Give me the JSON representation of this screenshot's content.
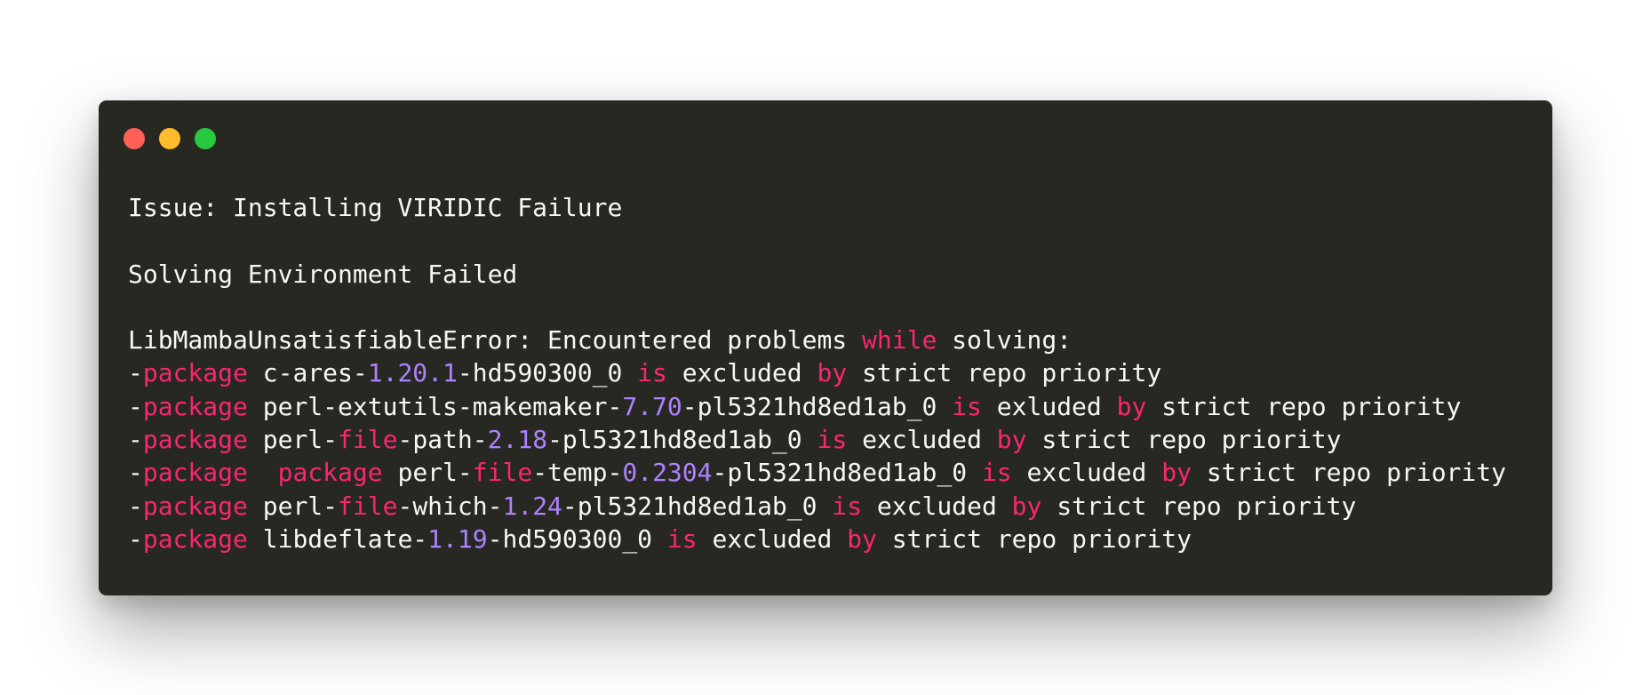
{
  "colors": {
    "background": "#ffffff",
    "window_bg": "#272822",
    "text": "#f8f8f2",
    "keyword": "#f92672",
    "number": "#ae81ff",
    "close": "#ff5f56",
    "minimize": "#ffbd2e",
    "zoom": "#27c93f"
  },
  "window_controls": [
    {
      "name": "close-button",
      "icon": "red-circle-icon",
      "color": "#ff5f56"
    },
    {
      "name": "minimize-button",
      "icon": "yellow-circle-icon",
      "color": "#ffbd2e"
    },
    {
      "name": "zoom-button",
      "icon": "green-circle-icon",
      "color": "#27c93f"
    }
  ],
  "code_lines": [
    [
      {
        "t": "Issue: Installing VIRIDIC Failure",
        "k": "plain"
      }
    ],
    [],
    [
      {
        "t": "Solving Environment Failed",
        "k": "plain"
      }
    ],
    [],
    [
      {
        "t": "LibMambaUnsatisfiableError: Encountered problems ",
        "k": "plain"
      },
      {
        "t": "while",
        "k": "kw"
      },
      {
        "t": " solving:",
        "k": "plain"
      }
    ],
    [
      {
        "t": "-",
        "k": "plain"
      },
      {
        "t": "package",
        "k": "kw"
      },
      {
        "t": " c-ares-",
        "k": "plain"
      },
      {
        "t": "1.20.1",
        "k": "num"
      },
      {
        "t": "-hd590300_0 ",
        "k": "plain"
      },
      {
        "t": "is",
        "k": "kw"
      },
      {
        "t": " excluded ",
        "k": "plain"
      },
      {
        "t": "by",
        "k": "kw"
      },
      {
        "t": " strict repo priority",
        "k": "plain"
      }
    ],
    [
      {
        "t": "-",
        "k": "plain"
      },
      {
        "t": "package",
        "k": "kw"
      },
      {
        "t": " perl-extutils-makemaker-",
        "k": "plain"
      },
      {
        "t": "7.70",
        "k": "num"
      },
      {
        "t": "-pl5321hd8ed1ab_0 ",
        "k": "plain"
      },
      {
        "t": "is",
        "k": "kw"
      },
      {
        "t": " exluded ",
        "k": "plain"
      },
      {
        "t": "by",
        "k": "kw"
      },
      {
        "t": " strict repo priority",
        "k": "plain"
      }
    ],
    [
      {
        "t": "-",
        "k": "plain"
      },
      {
        "t": "package",
        "k": "kw"
      },
      {
        "t": " perl-",
        "k": "plain"
      },
      {
        "t": "file",
        "k": "kw"
      },
      {
        "t": "-path-",
        "k": "plain"
      },
      {
        "t": "2.18",
        "k": "num"
      },
      {
        "t": "-pl5321hd8ed1ab_0 ",
        "k": "plain"
      },
      {
        "t": "is",
        "k": "kw"
      },
      {
        "t": " excluded ",
        "k": "plain"
      },
      {
        "t": "by",
        "k": "kw"
      },
      {
        "t": " strict repo priority",
        "k": "plain"
      }
    ],
    [
      {
        "t": "-",
        "k": "plain"
      },
      {
        "t": "package",
        "k": "kw"
      },
      {
        "t": "  ",
        "k": "plain"
      },
      {
        "t": "package",
        "k": "kw"
      },
      {
        "t": " perl-",
        "k": "plain"
      },
      {
        "t": "file",
        "k": "kw"
      },
      {
        "t": "-temp-",
        "k": "plain"
      },
      {
        "t": "0.2304",
        "k": "num"
      },
      {
        "t": "-pl5321hd8ed1ab_0 ",
        "k": "plain"
      },
      {
        "t": "is",
        "k": "kw"
      },
      {
        "t": " excluded ",
        "k": "plain"
      },
      {
        "t": "by",
        "k": "kw"
      },
      {
        "t": " strict repo priority",
        "k": "plain"
      }
    ],
    [
      {
        "t": "-",
        "k": "plain"
      },
      {
        "t": "package",
        "k": "kw"
      },
      {
        "t": " perl-",
        "k": "plain"
      },
      {
        "t": "file",
        "k": "kw"
      },
      {
        "t": "-which-",
        "k": "plain"
      },
      {
        "t": "1.24",
        "k": "num"
      },
      {
        "t": "-pl5321hd8ed1ab_0 ",
        "k": "plain"
      },
      {
        "t": "is",
        "k": "kw"
      },
      {
        "t": " excluded ",
        "k": "plain"
      },
      {
        "t": "by",
        "k": "kw"
      },
      {
        "t": " strict repo priority",
        "k": "plain"
      }
    ],
    [
      {
        "t": "-",
        "k": "plain"
      },
      {
        "t": "package",
        "k": "kw"
      },
      {
        "t": " libdeflate-",
        "k": "plain"
      },
      {
        "t": "1.19",
        "k": "num"
      },
      {
        "t": "-hd590300_0 ",
        "k": "plain"
      },
      {
        "t": "is",
        "k": "kw"
      },
      {
        "t": " excluded ",
        "k": "plain"
      },
      {
        "t": "by",
        "k": "kw"
      },
      {
        "t": " strict repo priority",
        "k": "plain"
      }
    ]
  ]
}
